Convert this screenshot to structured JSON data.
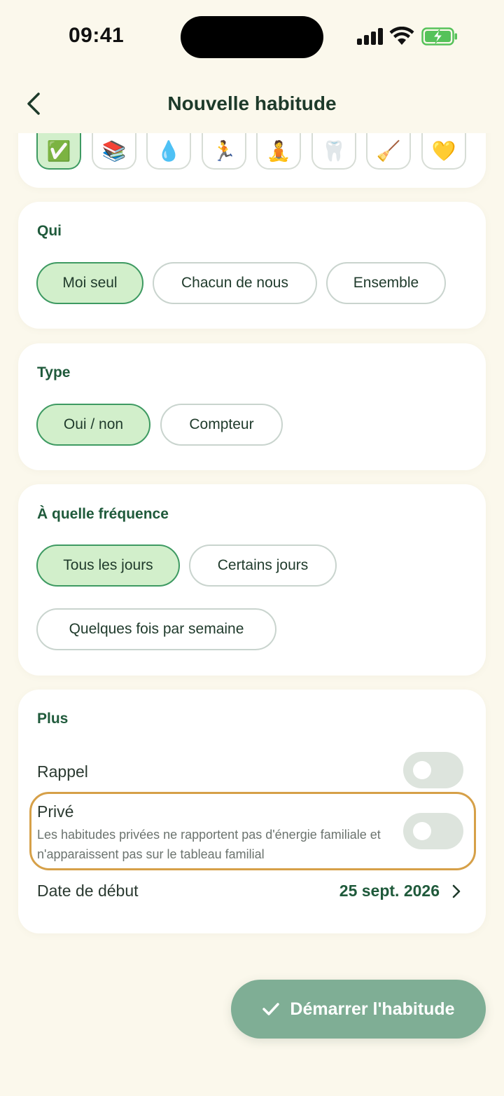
{
  "status": {
    "time": "09:41"
  },
  "header": {
    "title": "Nouvelle habitude"
  },
  "emojis": [
    "✅",
    "📚",
    "💧",
    "🏃",
    "🧘",
    "🦷",
    "🧹",
    "💛"
  ],
  "who": {
    "label": "Qui",
    "options": [
      "Moi seul",
      "Chacun de nous",
      "Ensemble"
    ],
    "selected": "Moi seul"
  },
  "type": {
    "label": "Type",
    "options": [
      "Oui / non",
      "Compteur"
    ],
    "selected": "Oui / non"
  },
  "frequency": {
    "label": "À quelle fréquence",
    "options": [
      "Tous les jours",
      "Certains jours",
      "Quelques fois par semaine"
    ],
    "selected": "Tous les jours"
  },
  "more": {
    "label": "Plus",
    "reminder": {
      "label": "Rappel",
      "enabled": false
    },
    "private": {
      "label": "Privé",
      "description": "Les habitudes privées ne rapportent pas d'énergie familiale et n'apparaissent pas sur le tableau familial",
      "enabled": false
    },
    "start_date": {
      "label": "Date de début",
      "value": "25 sept. 2026"
    }
  },
  "footer": {
    "start_label": "Démarrer l'habitude"
  },
  "colors": {
    "accent": "#1f5a3b",
    "selected_bg": "#d2efcb",
    "button_bg": "#7fae95",
    "highlight": "#d6a048"
  }
}
